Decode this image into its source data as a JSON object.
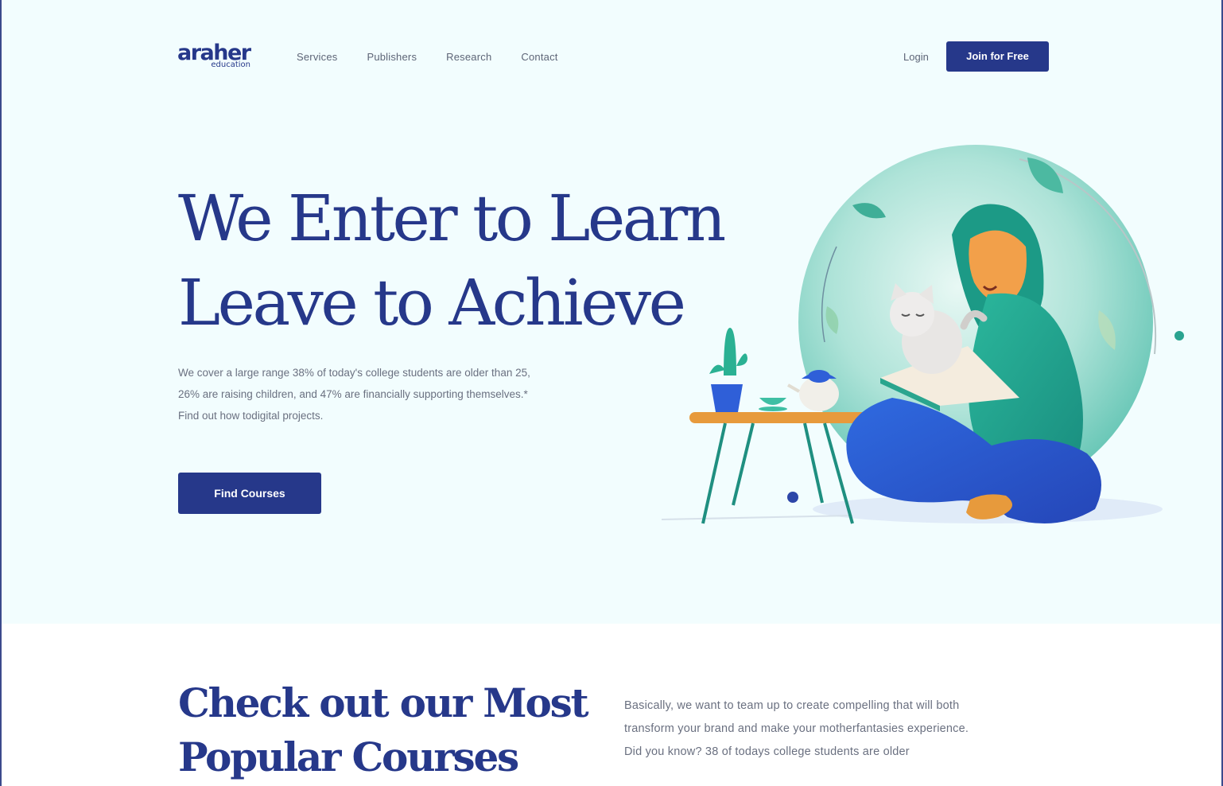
{
  "header": {
    "logo_main": "araher",
    "logo_sub": "education",
    "nav": [
      "Services",
      "Publishers",
      "Research",
      "Contact"
    ],
    "login_label": "Login",
    "join_label": "Join for Free"
  },
  "hero": {
    "title_line1": "We Enter to Learn",
    "title_line2": "Leave to Achieve",
    "desc_line1": "We cover a large range 38% of today's college students are older than 25,",
    "desc_line2": "26% are raising children, and 47% are financially supporting themselves.*",
    "desc_line3": "Find out how todigital projects.",
    "cta_label": "Find Courses"
  },
  "courses": {
    "title_line1": "Check out our Most",
    "title_line2": "Popular Courses",
    "desc_line1": "Basically, we want to team up to create compelling that will both",
    "desc_line2": "transform your brand and make your motherfantasies experience.",
    "desc_line3": "Did you know? 38 of todays college students are older"
  },
  "colors": {
    "brand_navy": "#26388a",
    "hero_bg": "#f2fdfe",
    "teal": "#1fa58f",
    "blue": "#2f5fd8",
    "orange": "#e79a3c"
  }
}
